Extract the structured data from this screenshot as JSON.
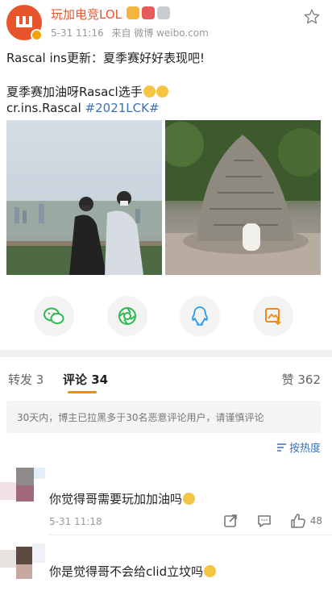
{
  "post": {
    "author": "玩加电竞LOL",
    "time": "5-31 11:16",
    "source": "来自 微博 weibo.com",
    "lines": [
      "Rascal ins更新：夏季赛好好表现吧!",
      "夏季赛加油呀Rasacl选手",
      "cr.ins.Rascal "
    ],
    "hashtag": "#2021LCK#",
    "images": [
      "photo-two-people-city-view",
      "photo-stone-cairn"
    ]
  },
  "share": [
    "wechat-icon",
    "moments-icon",
    "qq-icon",
    "save-image-icon"
  ],
  "tabs": {
    "repost_label": "转发",
    "repost_count": "3",
    "comment_label": "评论",
    "comment_count": "34",
    "like_label": "赞",
    "like_count": "362"
  },
  "notice": "30天内，博主已拉黑多于30名恶意评论用户，请谨慎评论",
  "sort_label": "按热度",
  "comments": [
    {
      "text": "你觉得哥需要玩加加油吗",
      "time": "5-31 11:18",
      "likes": "48"
    },
    {
      "text": "你是觉得哥不会给clid立坟吗"
    }
  ],
  "colors": {
    "brand": "#e8542c",
    "link": "#3a71b5",
    "tab_accent": "#f08c14"
  }
}
